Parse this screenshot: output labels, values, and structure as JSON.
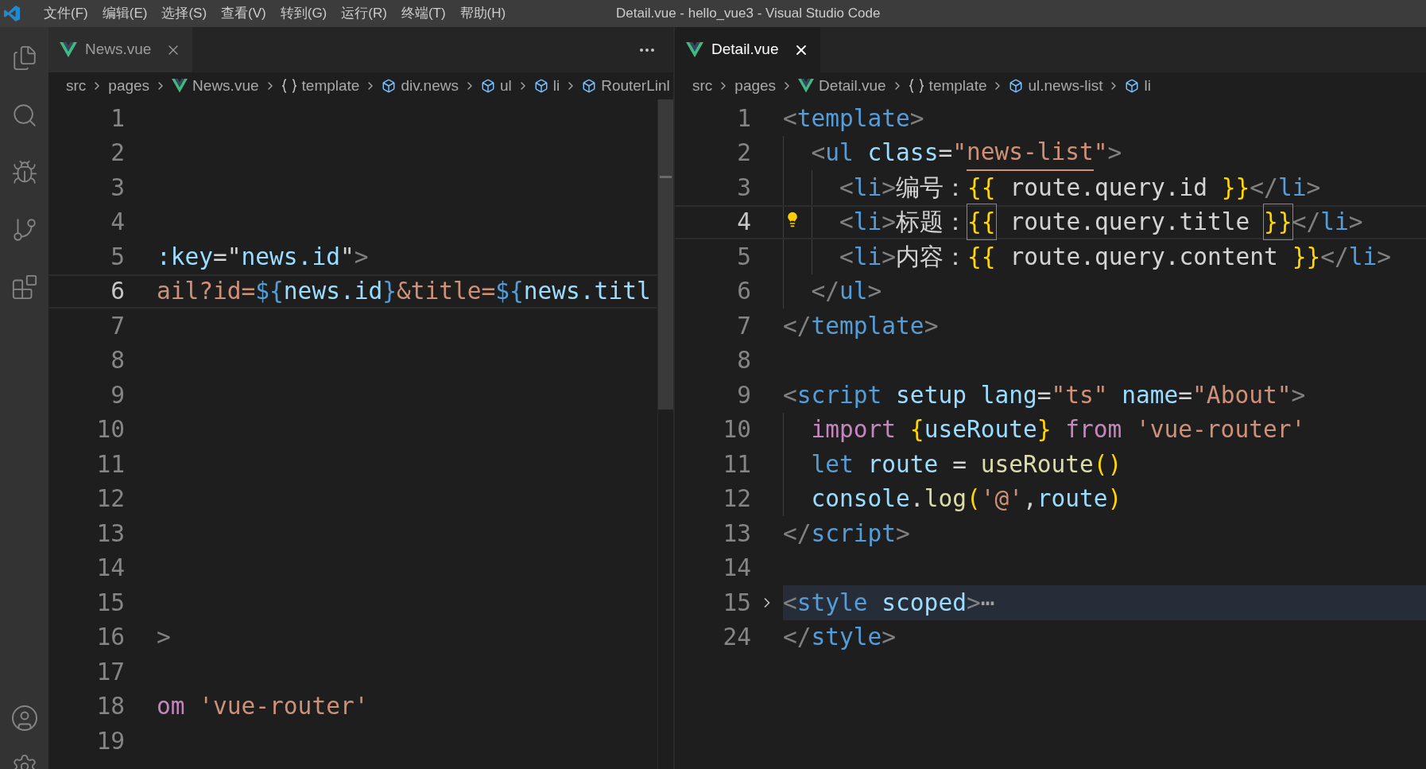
{
  "window": {
    "title": "Detail.vue - hello_vue3 - Visual Studio Code",
    "menu": [
      "文件(F)",
      "编辑(E)",
      "选择(S)",
      "查看(V)",
      "转到(G)",
      "运行(R)",
      "终端(T)",
      "帮助(H)"
    ]
  },
  "editors": [
    {
      "tabs": [
        {
          "label": "News.vue",
          "selected": false
        }
      ],
      "breadcrumbs": [
        {
          "label": "src",
          "kind": "folder"
        },
        {
          "label": "pages",
          "kind": "folder"
        },
        {
          "label": "News.vue",
          "kind": "vue"
        },
        {
          "label": "template",
          "kind": "namespace"
        },
        {
          "label": "div.news",
          "kind": "element"
        },
        {
          "label": "ul",
          "kind": "element"
        },
        {
          "label": "li",
          "kind": "element"
        },
        {
          "label": "RouterLinl",
          "kind": "element"
        }
      ],
      "lines": [
        {
          "number": "1",
          "current": false
        },
        {
          "number": "2",
          "current": false
        },
        {
          "number": "3",
          "current": false
        },
        {
          "number": "4",
          "current": false
        },
        {
          "number": "5",
          "current": false,
          "tokens": [
            {
              "text": ":key",
              "kind": "attr"
            },
            {
              "text": "=",
              "kind": "text"
            },
            {
              "text": "\"",
              "kind": "text"
            },
            {
              "text": "news.id",
              "kind": "var"
            },
            {
              "text": "\"",
              "kind": "text"
            },
            {
              "text": ">",
              "kind": "punct"
            }
          ]
        },
        {
          "number": "6",
          "current": true,
          "tokens": [
            {
              "text": "ail?id=",
              "kind": "string"
            },
            {
              "text": "${",
              "kind": "storage"
            },
            {
              "text": "news.id",
              "kind": "var"
            },
            {
              "text": "}",
              "kind": "storage"
            },
            {
              "text": "&title=",
              "kind": "string"
            },
            {
              "text": "${",
              "kind": "storage"
            },
            {
              "text": "news.titl",
              "kind": "var"
            }
          ]
        },
        {
          "number": "7",
          "current": false
        },
        {
          "number": "8",
          "current": false
        },
        {
          "number": "9",
          "current": false
        },
        {
          "number": "10",
          "current": false
        },
        {
          "number": "11",
          "current": false
        },
        {
          "number": "12",
          "current": false
        },
        {
          "number": "13",
          "current": false
        },
        {
          "number": "14",
          "current": false
        },
        {
          "number": "15",
          "current": false
        },
        {
          "number": "16",
          "current": false,
          "tokens": [
            {
              "text": ">",
              "kind": "punct"
            }
          ]
        },
        {
          "number": "17",
          "current": false
        },
        {
          "number": "18",
          "current": false,
          "tokens": [
            {
              "text": "om",
              "kind": "keyword"
            },
            {
              "text": " 'vue-router'",
              "kind": "string"
            }
          ]
        },
        {
          "number": "19",
          "current": false
        }
      ]
    },
    {
      "tabs": [
        {
          "label": "Detail.vue",
          "selected": true
        }
      ],
      "breadcrumbs": [
        {
          "label": "src",
          "kind": "folder"
        },
        {
          "label": "pages",
          "kind": "folder"
        },
        {
          "label": "Detail.vue",
          "kind": "vue"
        },
        {
          "label": "template",
          "kind": "namespace"
        },
        {
          "label": "ul.news-list",
          "kind": "element"
        },
        {
          "label": "li",
          "kind": "element"
        }
      ],
      "lines": [
        {
          "number": "1",
          "current": false,
          "tokens": [
            {
              "text": "<",
              "kind": "punct"
            },
            {
              "text": "template",
              "kind": "tag"
            },
            {
              "text": ">",
              "kind": "punct"
            }
          ]
        },
        {
          "number": "2",
          "current": false,
          "tokens": [
            {
              "text": "  <",
              "kind": "punct"
            },
            {
              "text": "ul",
              "kind": "tag"
            },
            {
              "text": " class",
              "kind": "attr"
            },
            {
              "text": "=",
              "kind": "text"
            },
            {
              "text": "\"",
              "kind": "string"
            },
            {
              "text": "news-list",
              "kind": "string",
              "underlined": true
            },
            {
              "text": "\"",
              "kind": "string"
            },
            {
              "text": ">",
              "kind": "punct"
            }
          ]
        },
        {
          "number": "3",
          "current": false,
          "tokens": [
            {
              "text": "    <",
              "kind": "punct"
            },
            {
              "text": "li",
              "kind": "tag"
            },
            {
              "text": ">",
              "kind": "punct"
            },
            {
              "text": "编号：",
              "kind": "text"
            },
            {
              "text": "{{",
              "kind": "brace"
            },
            {
              "text": " route.query.id ",
              "kind": "text"
            },
            {
              "text": "}}",
              "kind": "brace"
            },
            {
              "text": "</",
              "kind": "punct"
            },
            {
              "text": "li",
              "kind": "tag"
            },
            {
              "text": ">",
              "kind": "punct"
            }
          ]
        },
        {
          "number": "4",
          "current": true,
          "lightbulb": true,
          "tokens": [
            {
              "text": "    <",
              "kind": "punct"
            },
            {
              "text": "li",
              "kind": "tag"
            },
            {
              "text": ">",
              "kind": "punct"
            },
            {
              "text": "标题：",
              "kind": "text"
            },
            {
              "text": "{{",
              "kind": "brace",
              "matched": true
            },
            {
              "text": " route.query.title ",
              "kind": "text"
            },
            {
              "text": "}}",
              "kind": "brace",
              "matched": true
            },
            {
              "text": "</",
              "kind": "punct"
            },
            {
              "text": "li",
              "kind": "tag"
            },
            {
              "text": ">",
              "kind": "punct"
            }
          ]
        },
        {
          "number": "5",
          "current": false,
          "tokens": [
            {
              "text": "    <",
              "kind": "punct"
            },
            {
              "text": "li",
              "kind": "tag"
            },
            {
              "text": ">",
              "kind": "punct"
            },
            {
              "text": "内容：",
              "kind": "text"
            },
            {
              "text": "{{",
              "kind": "brace"
            },
            {
              "text": " route.query.content ",
              "kind": "text"
            },
            {
              "text": "}}",
              "kind": "brace"
            },
            {
              "text": "</",
              "kind": "punct"
            },
            {
              "text": "li",
              "kind": "tag"
            },
            {
              "text": ">",
              "kind": "punct"
            }
          ]
        },
        {
          "number": "6",
          "current": false,
          "tokens": [
            {
              "text": "  </",
              "kind": "punct"
            },
            {
              "text": "ul",
              "kind": "tag"
            },
            {
              "text": ">",
              "kind": "punct"
            }
          ]
        },
        {
          "number": "7",
          "current": false,
          "tokens": [
            {
              "text": "</",
              "kind": "punct"
            },
            {
              "text": "template",
              "kind": "tag"
            },
            {
              "text": ">",
              "kind": "punct"
            }
          ]
        },
        {
          "number": "8",
          "current": false
        },
        {
          "number": "9",
          "current": false,
          "tokens": [
            {
              "text": "<",
              "kind": "punct"
            },
            {
              "text": "script",
              "kind": "tag"
            },
            {
              "text": " setup lang",
              "kind": "attr"
            },
            {
              "text": "=",
              "kind": "text"
            },
            {
              "text": "\"ts\"",
              "kind": "string"
            },
            {
              "text": " name",
              "kind": "attr"
            },
            {
              "text": "=",
              "kind": "text"
            },
            {
              "text": "\"About\"",
              "kind": "string"
            },
            {
              "text": ">",
              "kind": "punct"
            }
          ]
        },
        {
          "number": "10",
          "current": false,
          "tokens": [
            {
              "text": "  import",
              "kind": "keyword"
            },
            {
              "text": " {",
              "kind": "brace"
            },
            {
              "text": "useRoute",
              "kind": "var"
            },
            {
              "text": "}",
              "kind": "brace"
            },
            {
              "text": " from",
              "kind": "keyword"
            },
            {
              "text": " 'vue-router'",
              "kind": "string"
            }
          ]
        },
        {
          "number": "11",
          "current": false,
          "tokens": [
            {
              "text": "  let",
              "kind": "storage"
            },
            {
              "text": " route ",
              "kind": "var"
            },
            {
              "text": "=",
              "kind": "text"
            },
            {
              "text": " useRoute",
              "kind": "func"
            },
            {
              "text": "()",
              "kind": "brace"
            }
          ]
        },
        {
          "number": "12",
          "current": false,
          "tokens": [
            {
              "text": "  console",
              "kind": "var"
            },
            {
              "text": ".",
              "kind": "text"
            },
            {
              "text": "log",
              "kind": "func"
            },
            {
              "text": "(",
              "kind": "brace"
            },
            {
              "text": "'@'",
              "kind": "string"
            },
            {
              "text": ",",
              "kind": "text"
            },
            {
              "text": "route",
              "kind": "var"
            },
            {
              "text": ")",
              "kind": "brace"
            }
          ]
        },
        {
          "number": "13",
          "current": false,
          "tokens": [
            {
              "text": "</",
              "kind": "punct"
            },
            {
              "text": "script",
              "kind": "tag"
            },
            {
              "text": ">",
              "kind": "punct"
            }
          ]
        },
        {
          "number": "14",
          "current": false
        },
        {
          "number": "15",
          "current": false,
          "folded": true,
          "tokens": [
            {
              "text": "<",
              "kind": "punct"
            },
            {
              "text": "style",
              "kind": "tag"
            },
            {
              "text": " scoped",
              "kind": "attr"
            },
            {
              "text": ">",
              "kind": "punct"
            },
            {
              "text": "⋯",
              "kind": "fold"
            }
          ]
        },
        {
          "number": "24",
          "current": false,
          "tokens": [
            {
              "text": "</",
              "kind": "punct"
            },
            {
              "text": "style",
              "kind": "tag"
            },
            {
              "text": ">",
              "kind": "punct"
            }
          ]
        }
      ]
    }
  ]
}
